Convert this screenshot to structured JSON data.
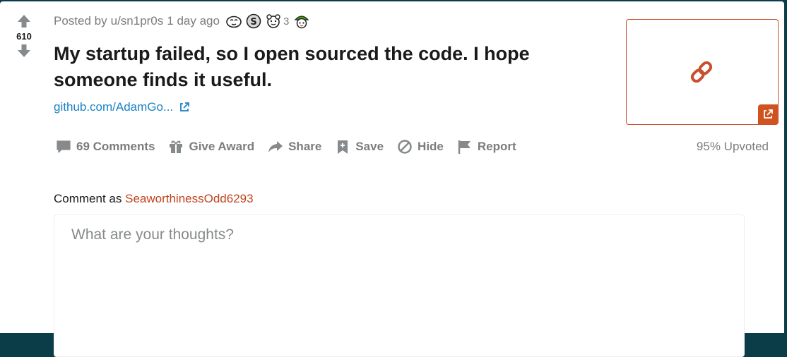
{
  "vote": {
    "count": "610"
  },
  "meta": {
    "posted_by": "Posted by",
    "user": "u/sn1pr0s",
    "time": "1 day ago",
    "award_count": "3"
  },
  "post": {
    "title": "My startup failed, so I open sourced the code. I hope someone finds it useful.",
    "link_text": "github.com/AdamGo..."
  },
  "actions": {
    "comments": "69 Comments",
    "give_award": "Give Award",
    "share": "Share",
    "save": "Save",
    "hide": "Hide",
    "report": "Report"
  },
  "upvoted": "95% Upvoted",
  "comment": {
    "label": "Comment as",
    "username": "SeaworthinessOdd6293",
    "placeholder": "What are your thoughts?"
  },
  "colors": {
    "background": "#0b3d49",
    "accent": "#d0531f",
    "link": "#1a82c6",
    "muted": "#7c7c7c"
  },
  "icons": [
    "upvote-arrow-icon",
    "downvote-arrow-icon",
    "award-icon",
    "external-link-icon",
    "chain-link-icon",
    "comment-icon",
    "gift-icon",
    "share-arrow-icon",
    "bookmark-icon",
    "hide-icon",
    "flag-icon"
  ]
}
